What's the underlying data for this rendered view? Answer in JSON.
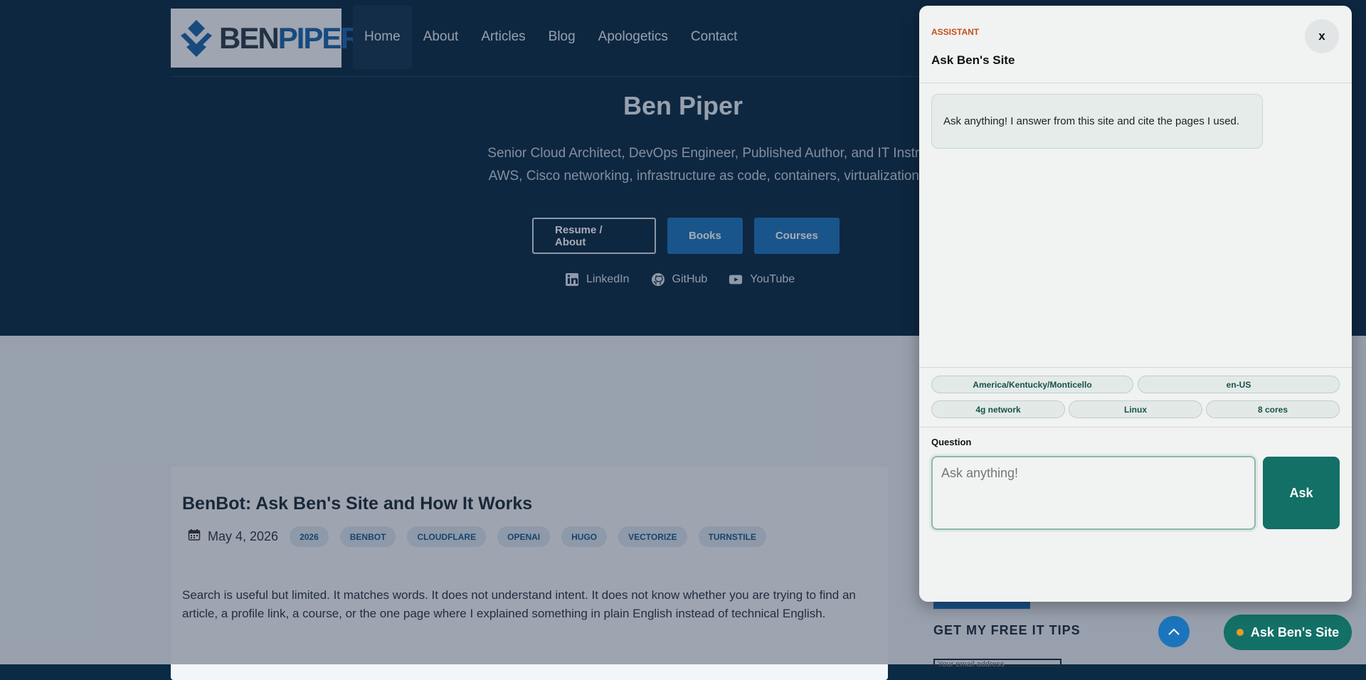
{
  "site": {
    "logo_text_a": "BEN",
    "logo_text_b": "PIPER",
    "nav": [
      "Home",
      "About",
      "Articles",
      "Blog",
      "Apologetics",
      "Contact"
    ],
    "hero_title": "Ben Piper",
    "hero_sub_line1": "Senior Cloud Architect, DevOps Engineer, Published Author, and IT Instructor specia",
    "hero_sub_line2": "AWS, Cisco networking, infrastructure as code, containers, virtualization, and enterp",
    "buttons": {
      "resume": "Resume / About",
      "books": "Books",
      "courses": "Courses"
    },
    "socials": {
      "linkedin": "LinkedIn",
      "github": "GitHub",
      "youtube": "YouTube"
    }
  },
  "post": {
    "title": "BenBot: Ask Ben's Site and How It Works",
    "date": "May 4, 2026",
    "tags": [
      "2026",
      "BENBOT",
      "CLOUDFLARE",
      "OPENAI",
      "HUGO",
      "VECTORIZE",
      "TURNSTILE"
    ],
    "body": "Search is useful but limited. It matches words. It does not understand intent. It does not know whether you are trying to find an article, a profile link, a course, or the one page where I explained something in plain English instead of technical English."
  },
  "sidebar": {
    "tips_heading": "GET MY FREE IT TIPS",
    "email_placeholder": "Your email address"
  },
  "launcher": {
    "label": "Ask Ben's Site"
  },
  "assistant": {
    "eyebrow": "ASSISTANT",
    "title": "Ask Ben's Site",
    "close_label": "x",
    "greeting": "Ask anything! I answer from this site and cite the pages I used.",
    "context_chips": {
      "timezone": "America/Kentucky/Monticello",
      "locale": "en-US",
      "network": "4g network",
      "os": "Linux",
      "cores": "8 cores"
    },
    "question_label": "Question",
    "question_placeholder": "Ask anything!",
    "ask_button": "Ask"
  },
  "colors": {
    "brand_teal": "#127066",
    "accent_blue": "#1c75bc",
    "hero_bg": "#0b2a44",
    "eyebrow_orange": "#c4501a"
  }
}
